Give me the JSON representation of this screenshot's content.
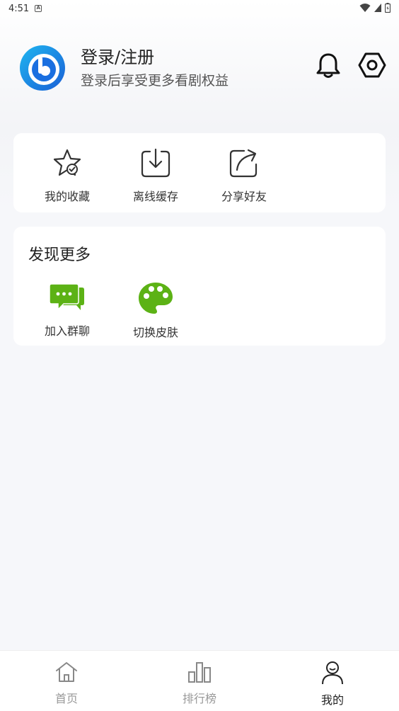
{
  "status_bar": {
    "time": "4:51",
    "notification_letter": "A"
  },
  "profile": {
    "title": "登录/注册",
    "subtitle": "登录后享受更多看剧权益"
  },
  "quick_actions": [
    {
      "label": "我的收藏",
      "icon": "star-check-icon"
    },
    {
      "label": "离线缓存",
      "icon": "download-box-icon"
    },
    {
      "label": "分享好友",
      "icon": "share-box-icon"
    }
  ],
  "discover": {
    "title": "发现更多",
    "items": [
      {
        "label": "加入群聊",
        "icon": "chat-bubbles-icon"
      },
      {
        "label": "切换皮肤",
        "icon": "palette-icon"
      }
    ]
  },
  "bottom_nav": [
    {
      "label": "首页",
      "icon": "home-icon"
    },
    {
      "label": "排行榜",
      "icon": "ranking-icon"
    },
    {
      "label": "我的",
      "icon": "user-icon",
      "active": true
    }
  ],
  "colors": {
    "brand_blue": "#1a6fe0",
    "accent_green": "#5cb215",
    "background": "#f6f7fa"
  }
}
